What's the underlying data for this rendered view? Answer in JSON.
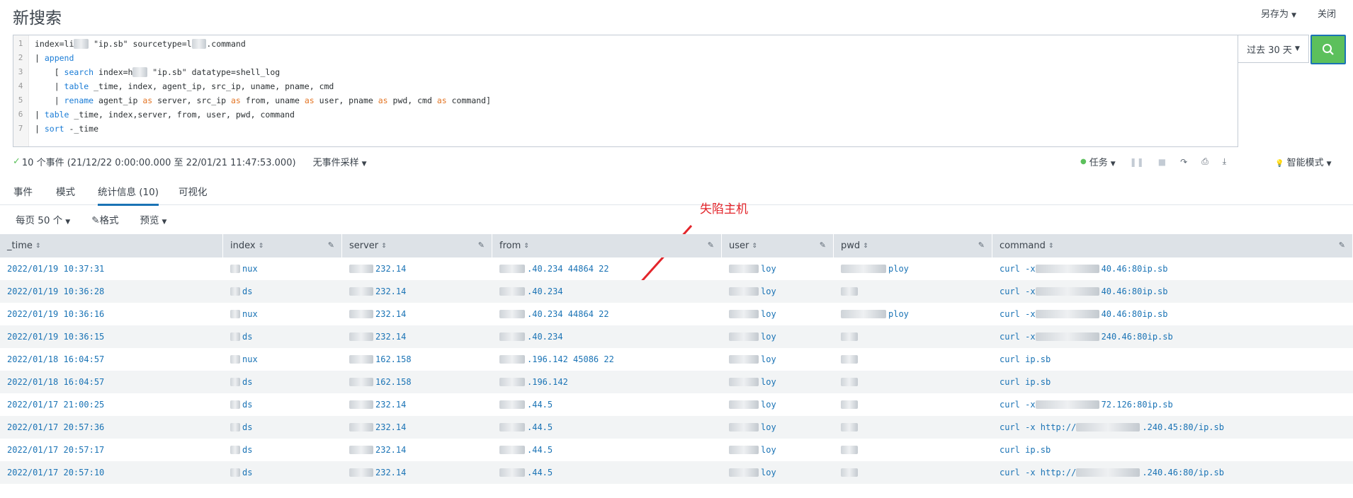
{
  "header": {
    "title": "新搜索",
    "save_as": "另存为",
    "close": "关闭"
  },
  "query_lines": [
    {
      "n": "1"
    },
    {
      "n": "2"
    },
    {
      "n": "3"
    },
    {
      "n": "4"
    },
    {
      "n": "5"
    },
    {
      "n": "6"
    },
    {
      "n": "7"
    }
  ],
  "time_range": "过去 30 天",
  "status": {
    "events_summary": "10 个事件 (21/12/22 0:00:00.000 至 22/01/21 11:47:53.000)",
    "sampling": "无事件采样",
    "job": "任务",
    "smart_mode": "智能模式"
  },
  "tabs": [
    {
      "label": "事件"
    },
    {
      "label": "模式"
    },
    {
      "label": "统计信息 (10)"
    },
    {
      "label": "可视化"
    }
  ],
  "options": {
    "per_page": "每页 50 个",
    "format": "格式",
    "preview": "预览"
  },
  "annotation": "失陷主机",
  "columns": [
    "_time",
    "index",
    "server",
    "from",
    "user",
    "pwd",
    "command"
  ],
  "rows": [
    {
      "time": "2022/01/19 10:37:31",
      "index": "nux",
      "server": "232.14",
      "from": ".40.234 44864 22",
      "user": "loy",
      "pwd": "ploy",
      "command": "curl -x",
      "command_tail": "40.46:80",
      "command_end": "ip.sb"
    },
    {
      "time": "2022/01/19 10:36:28",
      "index": "ds",
      "server": "232.14",
      "from": ".40.234",
      "user": "loy",
      "pwd": "",
      "command": "curl -x",
      "command_tail": "40.46:80",
      "command_end": "ip.sb"
    },
    {
      "time": "2022/01/19 10:36:16",
      "index": "nux",
      "server": "232.14",
      "from": ".40.234 44864 22",
      "user": "loy",
      "pwd": "ploy",
      "command": "curl -x",
      "command_tail": "40.46:80",
      "command_end": "ip.sb"
    },
    {
      "time": "2022/01/19 10:36:15",
      "index": "ds",
      "server": "232.14",
      "from": ".40.234",
      "user": "loy",
      "pwd": "",
      "command": "curl -x",
      "command_tail": "240.46:80",
      "command_end": "ip.sb"
    },
    {
      "time": "2022/01/18 16:04:57",
      "index": "nux",
      "server": "162.158",
      "from": ".196.142 45086 22",
      "user": "loy",
      "pwd": "",
      "command": "curl ip.sb",
      "command_tail": "",
      "command_end": ""
    },
    {
      "time": "2022/01/18 16:04:57",
      "index": "ds",
      "server": "162.158",
      "from": ".196.142",
      "user": "loy",
      "pwd": "",
      "command": "curl ip.sb",
      "command_tail": "",
      "command_end": ""
    },
    {
      "time": "2022/01/17 21:00:25",
      "index": "ds",
      "server": "232.14",
      "from": ".44.5",
      "user": "loy",
      "pwd": "",
      "command": "curl -x",
      "command_tail": "72.126:80",
      "command_end": "ip.sb"
    },
    {
      "time": "2022/01/17 20:57:36",
      "index": "ds",
      "server": "232.14",
      "from": ".44.5",
      "user": "loy",
      "pwd": "",
      "command": "curl -x http://",
      "command_tail": ".240.45:80/",
      "command_end": "ip.sb"
    },
    {
      "time": "2022/01/17 20:57:17",
      "index": "ds",
      "server": "232.14",
      "from": ".44.5",
      "user": "loy",
      "pwd": "",
      "command": "curl ip.sb",
      "command_tail": "",
      "command_end": ""
    },
    {
      "time": "2022/01/17 20:57:10",
      "index": "ds",
      "server": "232.14",
      "from": ".44.5",
      "user": "loy",
      "pwd": "",
      "command": "curl -x http://",
      "command_tail": ".240.46:80/",
      "command_end": "ip.sb"
    }
  ],
  "colors": {
    "link": "#1a73b5",
    "accent_green": "#5cc05c",
    "annotation_red": "#e3252b",
    "header_bg": "#dde2e7"
  }
}
